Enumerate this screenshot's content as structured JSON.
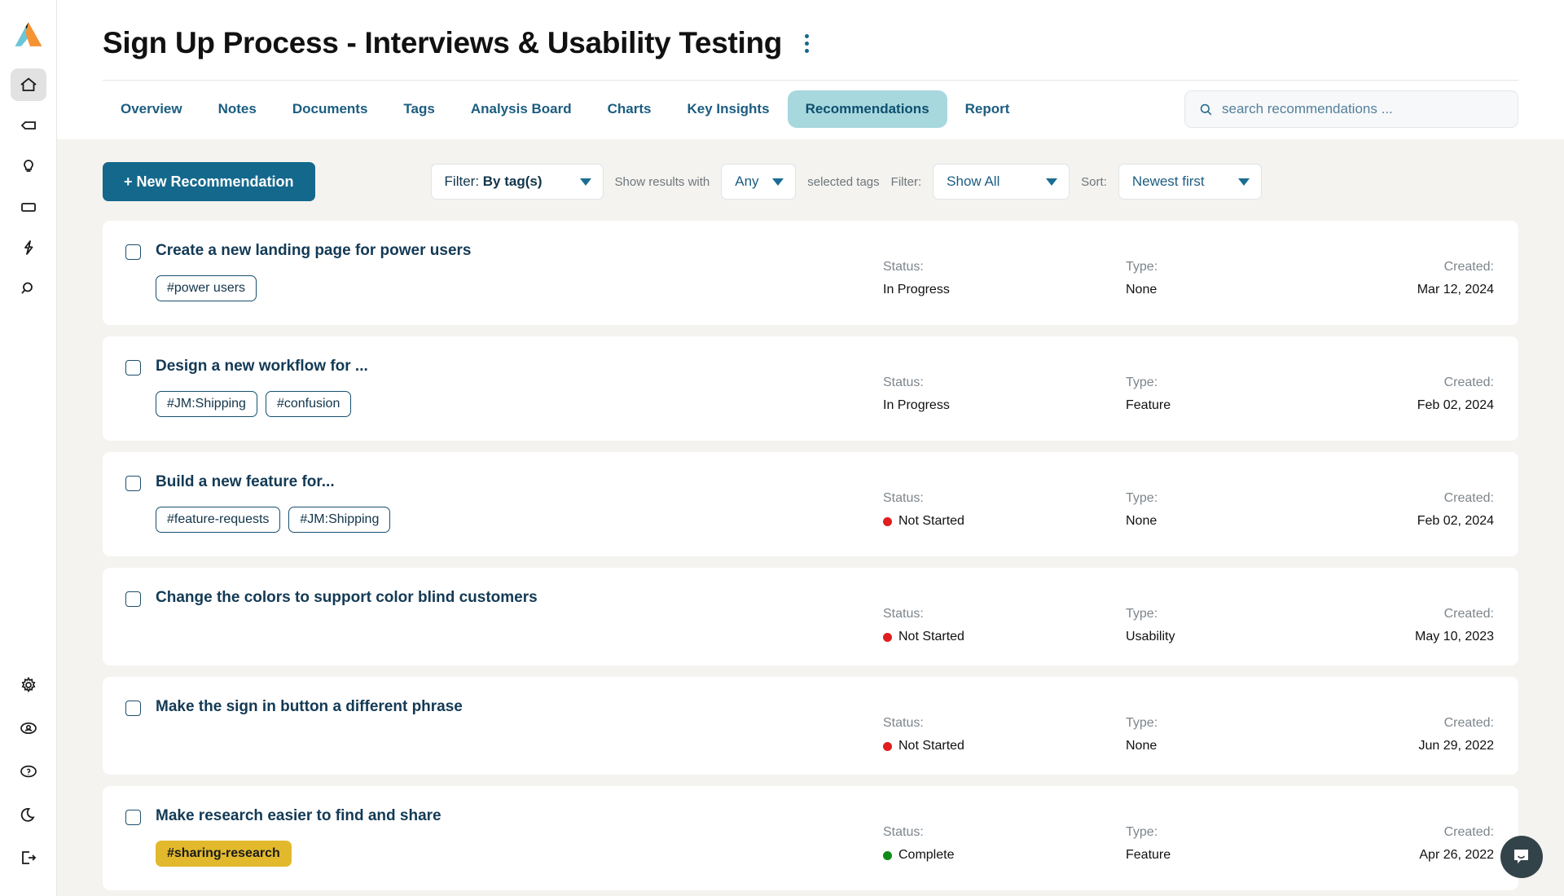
{
  "brand": {
    "logo_name": "aurelius-logo",
    "accent_dark": "#14688c",
    "accent_light": "#a7d8de",
    "tag_gold": "#e2b92c",
    "status_red": "#e01e1e",
    "status_green": "#108a18"
  },
  "rail": {
    "top_items": [
      {
        "name": "home-icon",
        "label": "Home",
        "active": true
      },
      {
        "name": "tag-icon",
        "label": "Tags",
        "active": false
      },
      {
        "name": "insight-icon",
        "label": "Insights",
        "active": false
      },
      {
        "name": "project-icon",
        "label": "Projects",
        "active": false
      },
      {
        "name": "bolt-icon",
        "label": "Quick Actions",
        "active": false
      },
      {
        "name": "search-icon",
        "label": "Search",
        "active": false
      }
    ],
    "bottom_items": [
      {
        "name": "gear-icon",
        "label": "Settings"
      },
      {
        "name": "account-icon",
        "label": "Account"
      },
      {
        "name": "help-icon",
        "label": "Help"
      },
      {
        "name": "moon-icon",
        "label": "Dark Mode"
      },
      {
        "name": "logout-icon",
        "label": "Log Out"
      }
    ]
  },
  "header": {
    "title": "Sign Up Process - Interviews & Usability Testing",
    "kebab_label": "More options"
  },
  "tabs": [
    {
      "label": "Overview",
      "active": false
    },
    {
      "label": "Notes",
      "active": false
    },
    {
      "label": "Documents",
      "active": false
    },
    {
      "label": "Tags",
      "active": false
    },
    {
      "label": "Analysis Board",
      "active": false
    },
    {
      "label": "Charts",
      "active": false
    },
    {
      "label": "Key Insights",
      "active": false
    },
    {
      "label": "Recommendations",
      "active": true
    },
    {
      "label": "Report",
      "active": false
    }
  ],
  "search": {
    "placeholder": "search recommendations ...",
    "value": "",
    "icon": "search-icon"
  },
  "toolbar": {
    "new_button": "+ New Recommendation",
    "tag_filter_prefix": "Filter:",
    "tag_filter_value": "By tag(s)",
    "show_results_with": "Show results with",
    "match_value": "Any",
    "selected_tags": "selected tags",
    "filter_label": "Filter:",
    "filter_value": "Show All",
    "sort_label": "Sort:",
    "sort_value": "Newest first"
  },
  "columns": {
    "status": "Status:",
    "type": "Type:",
    "created": "Created:"
  },
  "recommendations": [
    {
      "title": "Create a new landing page for power users",
      "tags": [
        {
          "label": "#power users",
          "style": "outline"
        }
      ],
      "status": "In Progress",
      "status_color": "",
      "type": "None",
      "created": "Mar 12, 2024",
      "checked": false
    },
    {
      "title": "Design a new workflow for ...",
      "tags": [
        {
          "label": "#JM:Shipping",
          "style": "outline"
        },
        {
          "label": "#confusion",
          "style": "outline"
        }
      ],
      "status": "In Progress",
      "status_color": "",
      "type": "Feature",
      "created": "Feb 02, 2024",
      "checked": false
    },
    {
      "title": "Build a new feature for...",
      "tags": [
        {
          "label": "#feature-requests",
          "style": "outline"
        },
        {
          "label": "#JM:Shipping",
          "style": "outline"
        }
      ],
      "status": "Not Started",
      "status_color": "#e01e1e",
      "type": "None",
      "created": "Feb 02, 2024",
      "checked": false
    },
    {
      "title": "Change the colors to support color blind customers",
      "tags": [],
      "status": "Not Started",
      "status_color": "#e01e1e",
      "type": "Usability",
      "created": "May 10, 2023",
      "checked": false
    },
    {
      "title": "Make the sign in button a different phrase",
      "tags": [],
      "status": "Not Started",
      "status_color": "#e01e1e",
      "type": "None",
      "created": "Jun 29, 2022",
      "checked": false
    },
    {
      "title": "Make research easier to find and share",
      "tags": [
        {
          "label": "#sharing-research",
          "style": "gold"
        }
      ],
      "status": "Complete",
      "status_color": "#108a18",
      "type": "Feature",
      "created": "Apr 26, 2022",
      "checked": false
    }
  ],
  "chat_widget": {
    "name": "intercom-chat-launcher",
    "label": "Open chat"
  }
}
